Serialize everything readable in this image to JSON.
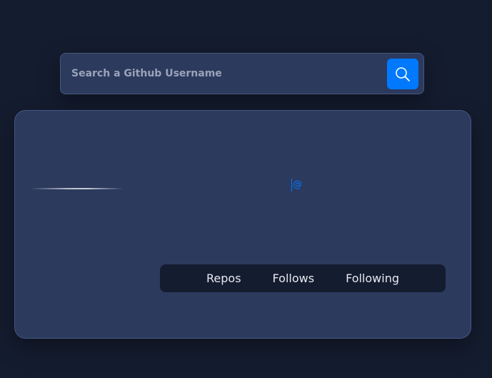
{
  "search": {
    "placeholder": "Search a Github Username",
    "value": "",
    "button_icon": "search-icon"
  },
  "profile": {
    "username_prefix": "@"
  },
  "stats": {
    "repos_label": "Repos",
    "follows_label": "Follows",
    "following_label": "Following"
  },
  "colors": {
    "background": "#141c2f",
    "card": "#2c3a5e",
    "accent": "#0079ff",
    "stats_bg": "#141c2f"
  }
}
